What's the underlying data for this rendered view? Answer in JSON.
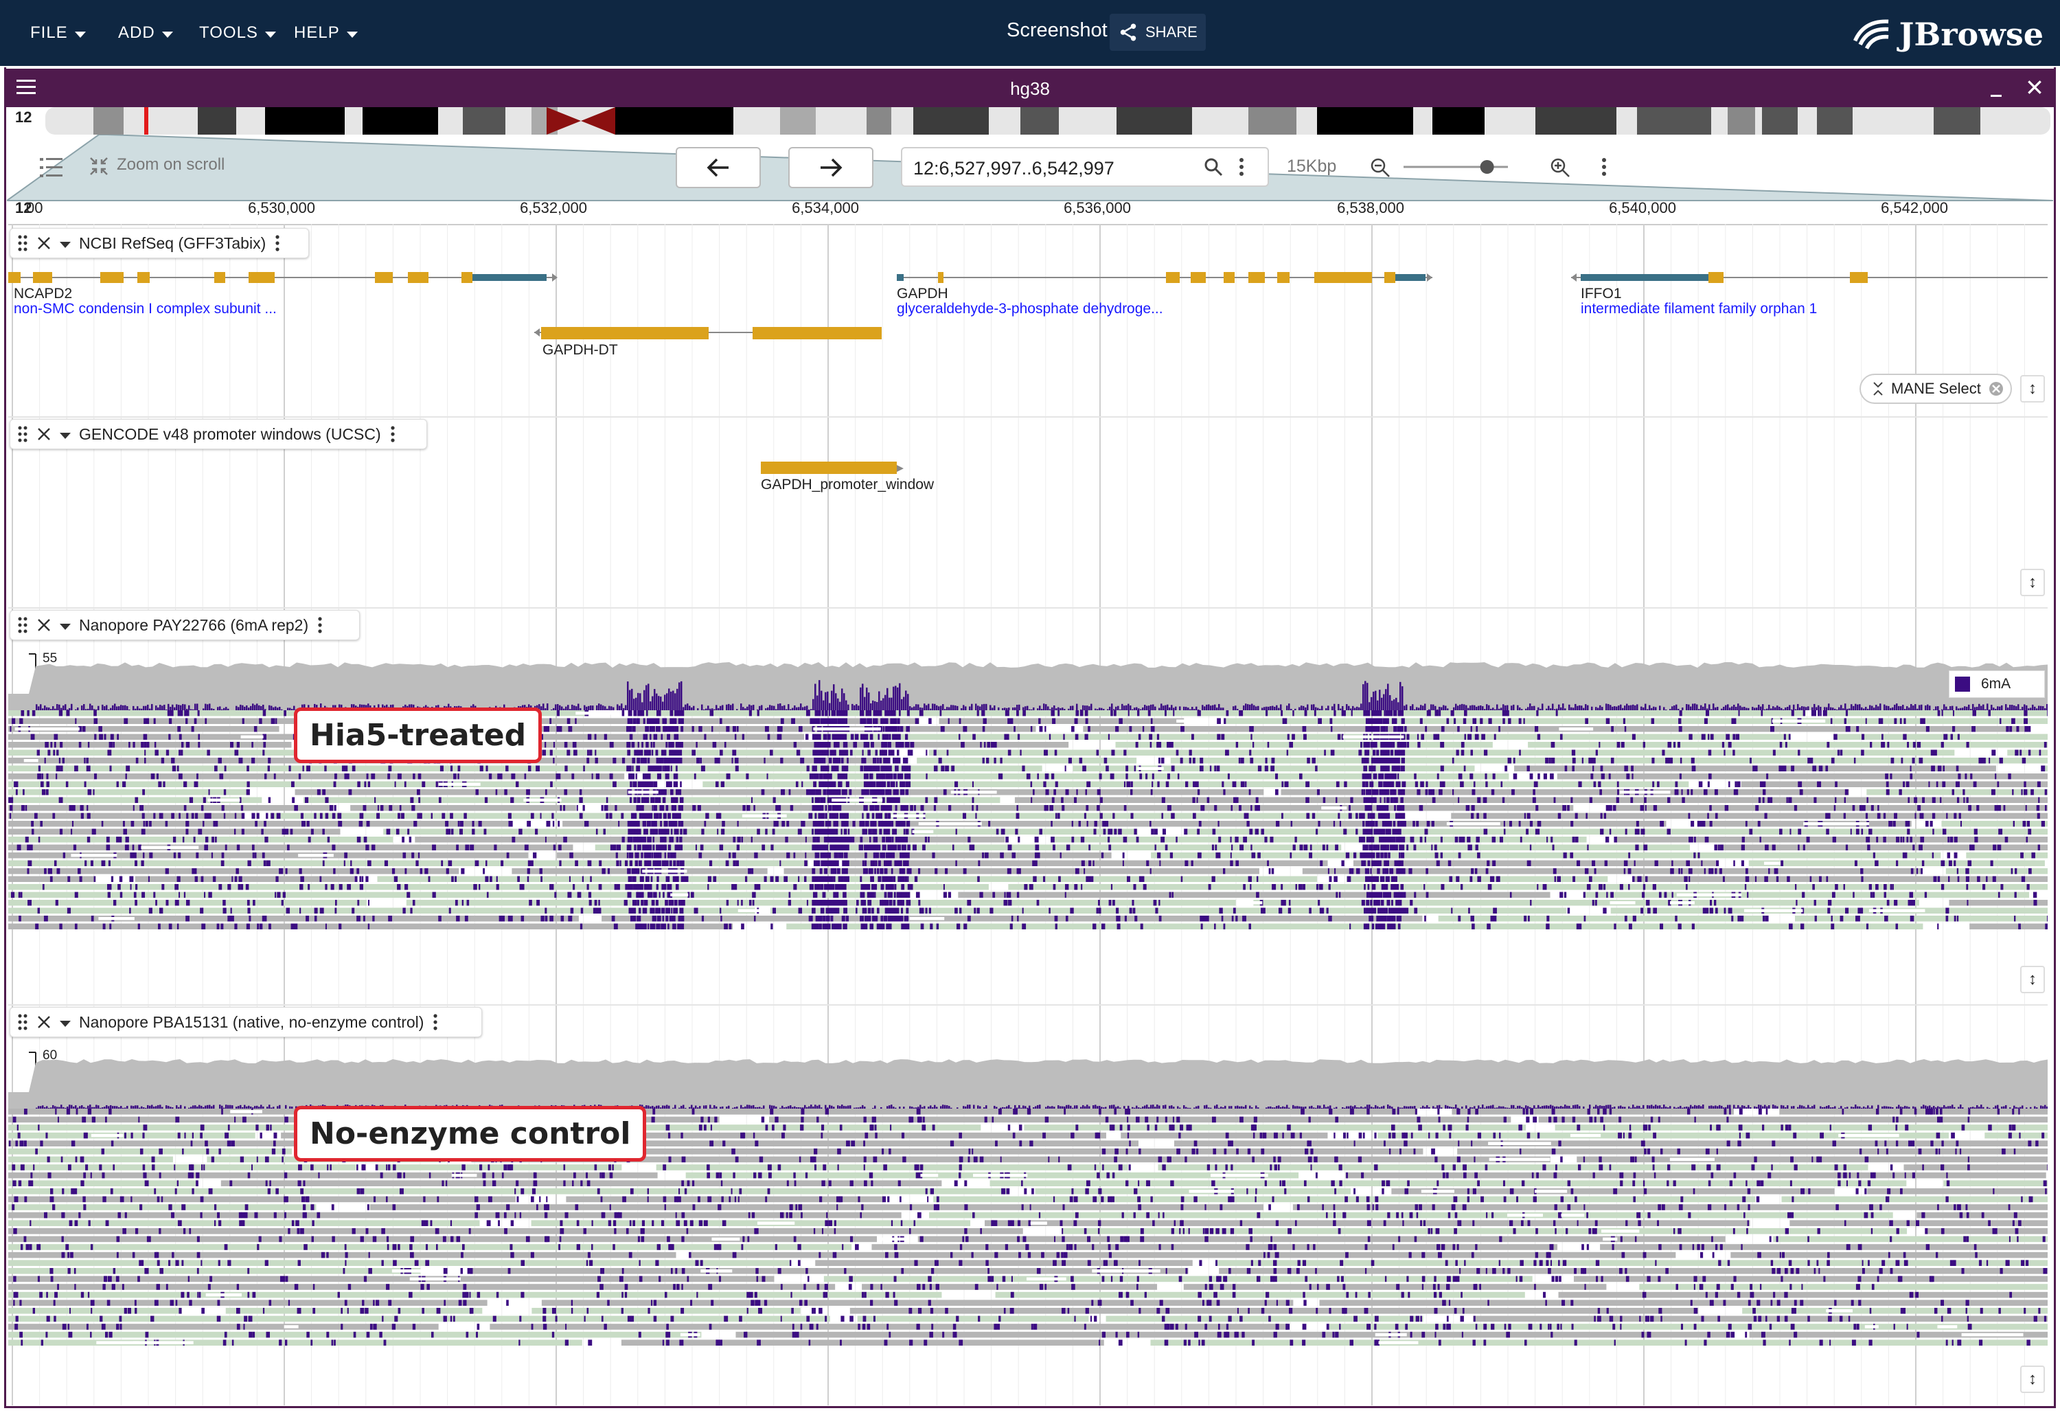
{
  "app_bar": {
    "menus": [
      "FILE",
      "ADD",
      "TOOLS",
      "HELP"
    ],
    "screenshot_label": "Screenshot",
    "share_label": "SHARE",
    "logo_text": "JBrowse"
  },
  "view": {
    "title": "hg38",
    "chromosome": "12",
    "zoom_on_scroll": "Zoom on scroll",
    "location": "12:6,527,997..6,542,997",
    "bp_per_view": "15Kbp",
    "zoom_slider_fraction": 0.8
  },
  "ruler": {
    "start_label": "12",
    "start_partial": "00",
    "ticks": [
      "6,530,000",
      "6,532,000",
      "6,534,000",
      "6,536,000",
      "6,538,000",
      "6,540,000",
      "6,542,000"
    ]
  },
  "tracks": {
    "refseq": {
      "name": "NCBI RefSeq (GFF3Tabix)",
      "filter_chip": "MANE Select",
      "genes": [
        {
          "name": "NCAPD2",
          "description": "non-SMC condensin I complex subunit ..."
        },
        {
          "name": "GAPDH-DT",
          "description": ""
        },
        {
          "name": "GAPDH",
          "description": "glyceraldehyde-3-phosphate dehydroge..."
        },
        {
          "name": "IFFO1",
          "description": "intermediate filament family orphan 1"
        }
      ]
    },
    "gencode": {
      "name": "GENCODE v48 promoter windows (UCSC)",
      "features": [
        {
          "name": "GAPDH_promoter_window"
        }
      ]
    },
    "nanopore_treated": {
      "name": "Nanopore PAY22766 (6mA rep2)",
      "coverage_max": "55",
      "coverage_min": "0",
      "legend": "6mA",
      "annotation": "Hia5-treated"
    },
    "nanopore_control": {
      "name": "Nanopore PBA15131 (native, no-enzyme control)",
      "coverage_max": "60",
      "coverage_min": "0",
      "annotation": "No-enzyme control"
    }
  },
  "colors": {
    "app_bar": "#0f2742",
    "view_header": "#4f1a4d",
    "gene_exon": "#dba21c",
    "gene_utr": "#3a7086",
    "methylation": "#3b0c82",
    "read_unmodified": "#c8dcc5",
    "read_gray": "#b5b5b5",
    "annotation_border": "#e0262f"
  }
}
